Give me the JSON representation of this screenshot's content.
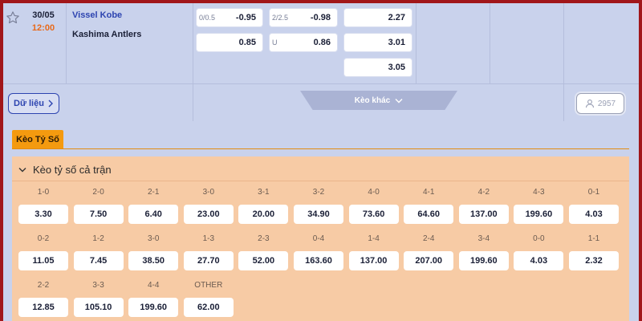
{
  "match": {
    "date": "30/05",
    "time": "12:00",
    "home_team": "Vissel Kobe",
    "away_team": "Kashima Antlers",
    "odds": {
      "handicap": [
        {
          "line": "0/0.5",
          "value": "-0.95"
        },
        {
          "line": "",
          "value": "0.85"
        }
      ],
      "over_under": [
        {
          "line": "2/2.5",
          "value": "-0.98"
        },
        {
          "line": "U",
          "value": "0.86"
        }
      ],
      "one_x_two": [
        "2.27",
        "3.01",
        "3.05"
      ]
    }
  },
  "actions": {
    "data_button": "Dữ liệu",
    "more_odds": "Kèo khác",
    "viewers": "2957"
  },
  "section": {
    "tab_label": "Kèo Tỷ Số",
    "panel_title": "Kèo tỷ số cả trận",
    "scores": [
      {
        "score": "1-0",
        "odds": "3.30"
      },
      {
        "score": "2-0",
        "odds": "7.50"
      },
      {
        "score": "2-1",
        "odds": "6.40"
      },
      {
        "score": "3-0",
        "odds": "23.00"
      },
      {
        "score": "3-1",
        "odds": "20.00"
      },
      {
        "score": "3-2",
        "odds": "34.90"
      },
      {
        "score": "4-0",
        "odds": "73.60"
      },
      {
        "score": "4-1",
        "odds": "64.60"
      },
      {
        "score": "4-2",
        "odds": "137.00"
      },
      {
        "score": "4-3",
        "odds": "199.60"
      },
      {
        "score": "0-1",
        "odds": "4.03"
      },
      {
        "score": "0-2",
        "odds": "11.05"
      },
      {
        "score": "1-2",
        "odds": "7.45"
      },
      {
        "score": "3-0",
        "odds": "38.50"
      },
      {
        "score": "1-3",
        "odds": "27.70"
      },
      {
        "score": "2-3",
        "odds": "52.00"
      },
      {
        "score": "0-4",
        "odds": "163.60"
      },
      {
        "score": "1-4",
        "odds": "137.00"
      },
      {
        "score": "2-4",
        "odds": "207.00"
      },
      {
        "score": "3-4",
        "odds": "199.60"
      },
      {
        "score": "0-0",
        "odds": "4.03"
      },
      {
        "score": "1-1",
        "odds": "2.32"
      },
      {
        "score": "2-2",
        "odds": "12.85"
      },
      {
        "score": "3-3",
        "odds": "105.10"
      },
      {
        "score": "4-4",
        "odds": "199.60"
      },
      {
        "score": "OTHER",
        "odds": "62.00"
      }
    ]
  },
  "colors": {
    "frame_border": "#a1161a",
    "background": "#c9d2ec",
    "accent_orange": "#f49a0f",
    "panel": "#f7cba5",
    "home_team": "#2d44b0",
    "time": "#e8691a"
  },
  "icons": [
    "star-icon",
    "chevron-right-icon",
    "chevron-down-icon",
    "user-icon"
  ]
}
